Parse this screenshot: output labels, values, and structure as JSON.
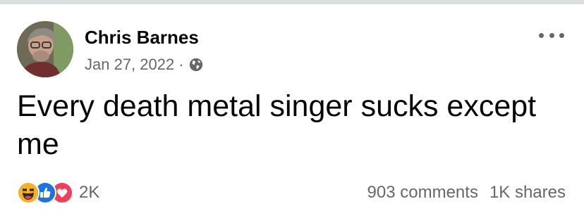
{
  "post": {
    "author": "Chris Barnes",
    "date": "Jan 27, 2022",
    "separator": "·",
    "visibility_icon": "globe-icon",
    "text": "Every death metal singer sucks except me"
  },
  "reactions": {
    "icons": [
      "haha-icon",
      "like-icon",
      "love-icon"
    ],
    "count": "2K"
  },
  "stats": {
    "comments": "903 comments",
    "shares": "1K shares"
  },
  "colors": {
    "like_blue": "#1b74e4",
    "love_red": "#f33e58",
    "haha_yellow": "#f7b125",
    "secondary_text": "#65676b"
  }
}
